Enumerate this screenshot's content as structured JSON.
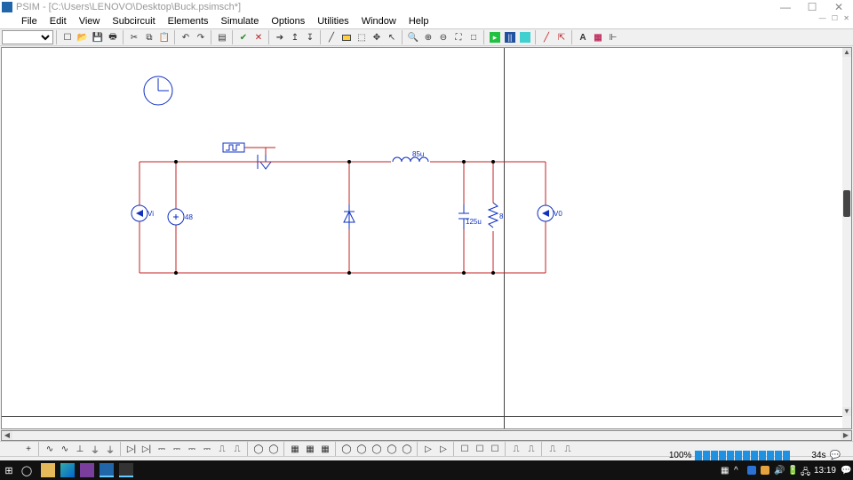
{
  "title": "PSIM - [C:\\Users\\LENOVO\\Desktop\\Buck.psimsch*]",
  "menu": {
    "file": "File",
    "edit": "Edit",
    "view": "View",
    "subcircuit": "Subcircuit",
    "elements": "Elements",
    "simulate": "Simulate",
    "options": "Options",
    "utilities": "Utilities",
    "window": "Window",
    "help": "Help"
  },
  "components": {
    "vsrc_label": "48",
    "vmeter_in": "Vi",
    "inductor": "85u",
    "capacitor": "125u",
    "resistor": "8",
    "vmeter_out": "V0"
  },
  "status": {
    "zoom": "100%",
    "time": "34s"
  },
  "os": {
    "clock": "13:19"
  },
  "win": {
    "min": "—",
    "max": "☐",
    "close": "✕"
  },
  "scroll": {
    "left": "◀",
    "right": "▶",
    "up": "▲",
    "down": "▼"
  }
}
